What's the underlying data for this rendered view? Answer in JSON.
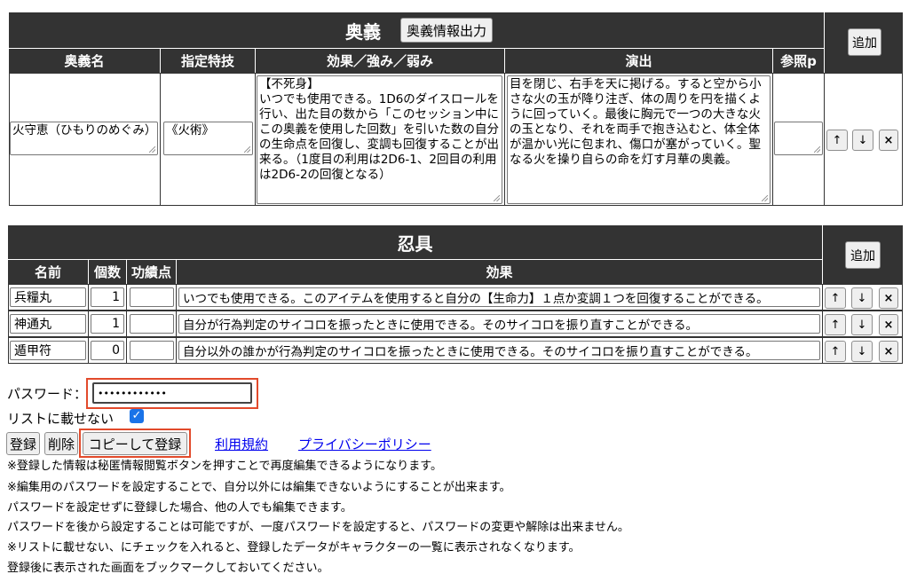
{
  "ougi": {
    "title": "奥義",
    "export_button": "奥義情報出力",
    "add_button": "追加",
    "headers": [
      "奥義名",
      "指定特技",
      "効果／強み／弱み",
      "演出",
      "参照p"
    ],
    "row": {
      "name": "火守恵（ひもりのめぐみ）",
      "skill": "《火術》",
      "effect": "【不死身】\nいつでも使用できる。1D6のダイスロールを行い、出た目の数から「このセッション中にこの奥義を使用した回数」を引いた数の自分の生命点を回復し、変調も回復することが出来る。（1度目の利用は2D6-1、2回目の利用は2D6-2の回復となる）",
      "performance": "目を閉じ、右手を天に掲げる。すると空から小さな火の玉が降り注ぎ、体の周りを円を描くように回っていく。最後に胸元で一つの大きな火の玉となり、それを両手で抱き込むと、体全体が温かい光に包まれ、傷口が塞がっていく。聖なる火を操り自らの命を灯す月華の奥義。",
      "page": ""
    }
  },
  "ningu": {
    "title": "忍具",
    "add_button": "追加",
    "headers": [
      "名前",
      "個数",
      "功績点",
      "効果"
    ],
    "rows": [
      {
        "name": "兵糧丸",
        "count": "1",
        "merit": "",
        "effect": "いつでも使用できる。このアイテムを使用すると自分の【生命力】１点か変調１つを回復することができる。"
      },
      {
        "name": "神通丸",
        "count": "1",
        "merit": "",
        "effect": "自分が行為判定のサイコロを振ったときに使用できる。そのサイコロを振り直すことができる。"
      },
      {
        "name": "遁甲符",
        "count": "0",
        "merit": "",
        "effect": "自分以外の誰かが行為判定のサイコロを振ったときに使用できる。そのサイコロを振り直すことができる。"
      }
    ]
  },
  "row_controls": {
    "up": "↑",
    "down": "↓",
    "delete": "×"
  },
  "form": {
    "password_label": "パスワード：",
    "password_value": "••••••••••••",
    "unlisted_label": "リストに載せない",
    "unlisted_checked": true,
    "register_button": "登録",
    "delete_button": "削除",
    "copy_register_button": "コピーして登録",
    "terms_link": "利用規約",
    "privacy_link": "プライバシーポリシー"
  },
  "notes": [
    "※登録した情報は秘匿情報閲覧ボタンを押すことで再度編集できるようになります。",
    "※編集用のパスワードを設定することで、自分以外には編集できないようにすることが出来ます。",
    "パスワードを設定せずに登録した場合、他の人でも編集できます。",
    "パスワードを後から設定することは可能ですが、一度パスワードを設定すると、パスワードの変更や解除は出来ません。",
    "※リストに載せない、にチェックを入れると、登録したデータがキャラクターの一覧に表示されなくなります。",
    "登録後に表示された画面をブックマークしておいてください。"
  ],
  "colors": {
    "header_bg": "#333333",
    "highlight": "#e24a2b",
    "link": "#0000ee",
    "check": "#1a73e8"
  }
}
